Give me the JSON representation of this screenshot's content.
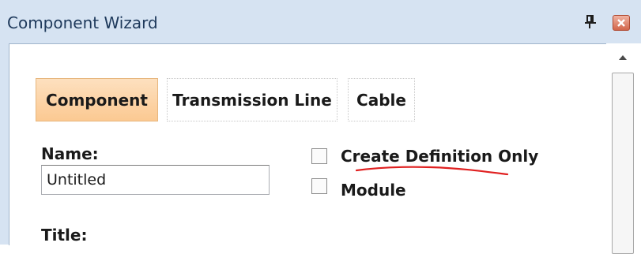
{
  "window": {
    "title": "Component Wizard",
    "pin_icon": "pin-icon",
    "close_icon": "close-icon"
  },
  "tabs": [
    {
      "label": "Component",
      "active": true
    },
    {
      "label": "Transmission Line",
      "active": false
    },
    {
      "label": "Cable",
      "active": false
    }
  ],
  "form": {
    "name_label": "Name:",
    "name_value": "Untitled",
    "title_label": "Title:",
    "create_definition_only": {
      "label": "Create Definition Only",
      "checked": false
    },
    "module": {
      "label": "Module",
      "checked": false
    }
  },
  "colors": {
    "active_tab": "#fbc992",
    "titlebar": "#d6e3f2",
    "annotation_underline": "#e02020"
  }
}
